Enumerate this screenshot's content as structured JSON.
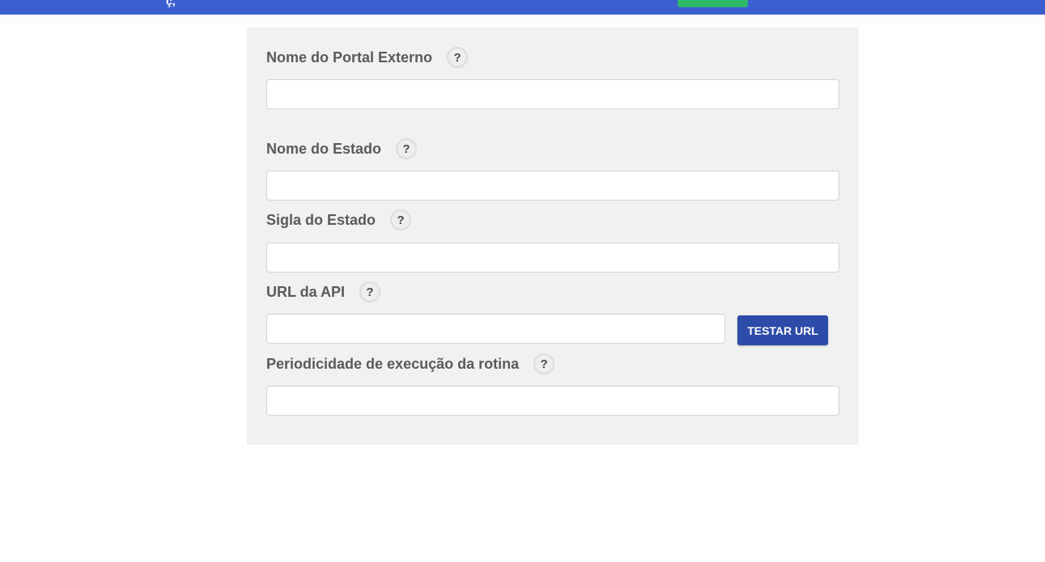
{
  "header": {
    "glyph": "ç,",
    "colors": {
      "bar": "#3b5fcf",
      "button": "#2fb76a"
    }
  },
  "form": {
    "fields": [
      {
        "label": "Nome do Portal Externo",
        "help": "?",
        "value": "",
        "placeholder": ""
      },
      {
        "label": "Nome do Estado",
        "help": "?",
        "value": "",
        "placeholder": ""
      },
      {
        "label": "Sigla do Estado",
        "help": "?",
        "value": "",
        "placeholder": ""
      },
      {
        "label": "URL da API",
        "help": "?",
        "value": "",
        "placeholder": ""
      },
      {
        "label": "Periodicidade de execução da rotina",
        "help": "?",
        "value": "",
        "placeholder": ""
      }
    ],
    "test_url_label": "TESTAR URL",
    "colors": {
      "panel_bg": "#f0f1f1",
      "button_bg": "#2d4ba8",
      "label_text": "#5a5a5a"
    }
  }
}
